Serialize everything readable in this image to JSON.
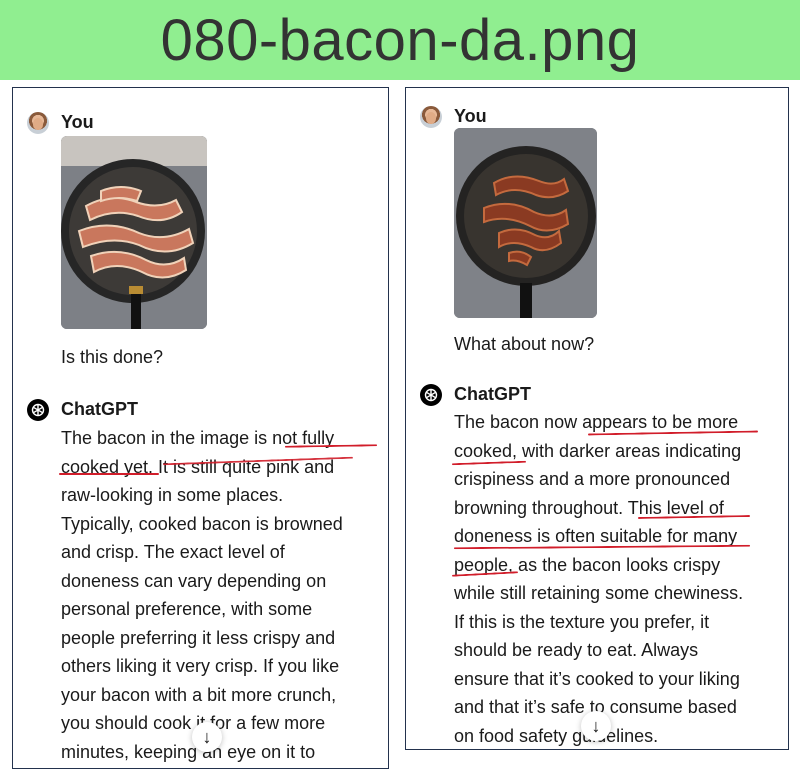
{
  "banner": {
    "title": "080-bacon-da.png"
  },
  "left": {
    "user_name": "You",
    "user_message": "Is this done?",
    "assistant_name": "ChatGPT",
    "reply_lines": [
      "The bacon in the image is not fully",
      "cooked yet. It is still quite pink and",
      "raw-looking in some places.",
      "Typically, cooked bacon is browned",
      "and crisp. The exact level of",
      "doneness can vary depending on",
      "personal preference, with some",
      "people preferring it less crispy and",
      "others liking it very crisp. If you like",
      "your bacon with a bit more crunch,",
      "you should cook it for a few more",
      "minutes, keeping an eye on it to"
    ],
    "scroll_button": "↓"
  },
  "right": {
    "user_name": "You",
    "user_message": "What about now?",
    "assistant_name": "ChatGPT",
    "reply_lines": [
      "The bacon now appears to be more",
      "cooked, with darker areas indicating",
      "crispiness and a more pronounced",
      "browning throughout. This level of",
      "doneness is often suitable for many",
      "people, as the bacon looks crispy",
      "while still retaining some chewiness.",
      "If this is the texture you prefer, it",
      "should be ready to eat. Always",
      "ensure that it’s cooked to your liking",
      "and that it’s safe to consume based",
      "on food safety guidelines."
    ],
    "scroll_button": "↓"
  },
  "colors": {
    "banner": "#90ee90",
    "underline": "#d11d2a",
    "border": "#23324d"
  }
}
